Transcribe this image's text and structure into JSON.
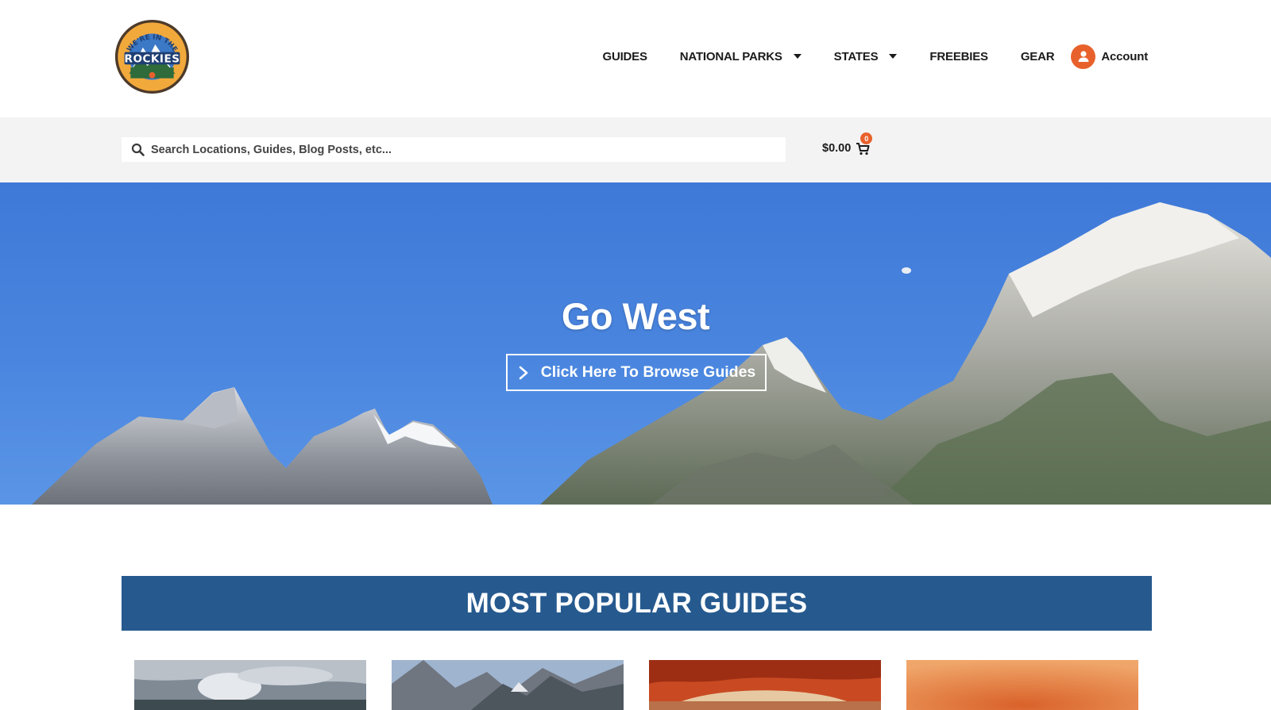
{
  "header": {
    "logo_icon": "rockies-badge-logo",
    "logo_text": {
      "top": "WE'RE IN THE",
      "main": "ROCKIES"
    },
    "nav": [
      {
        "label": "GUIDES",
        "has_dropdown": false
      },
      {
        "label": "NATIONAL PARKS",
        "has_dropdown": true
      },
      {
        "label": "STATES",
        "has_dropdown": true
      },
      {
        "label": "FREEBIES",
        "has_dropdown": false
      },
      {
        "label": "GEAR",
        "has_dropdown": false
      }
    ],
    "account": {
      "label": "Account",
      "icon": "user-icon"
    }
  },
  "search": {
    "placeholder": "Search Locations, Guides, Blog Posts, etc...",
    "value": "",
    "icon": "search-icon"
  },
  "cart": {
    "total": "$0.00",
    "count": "0",
    "icon": "cart-icon"
  },
  "hero": {
    "title": "Go West",
    "button_label": "Click Here To Browse Guides",
    "button_icon": "chevron-right-icon"
  },
  "popular": {
    "title": "MOST POPULAR GUIDES"
  },
  "colors": {
    "accent_orange": "#e8612c",
    "banner_blue": "#265a8f",
    "sky_blue": "#4a86df",
    "search_strip": "#f3f3f3"
  }
}
